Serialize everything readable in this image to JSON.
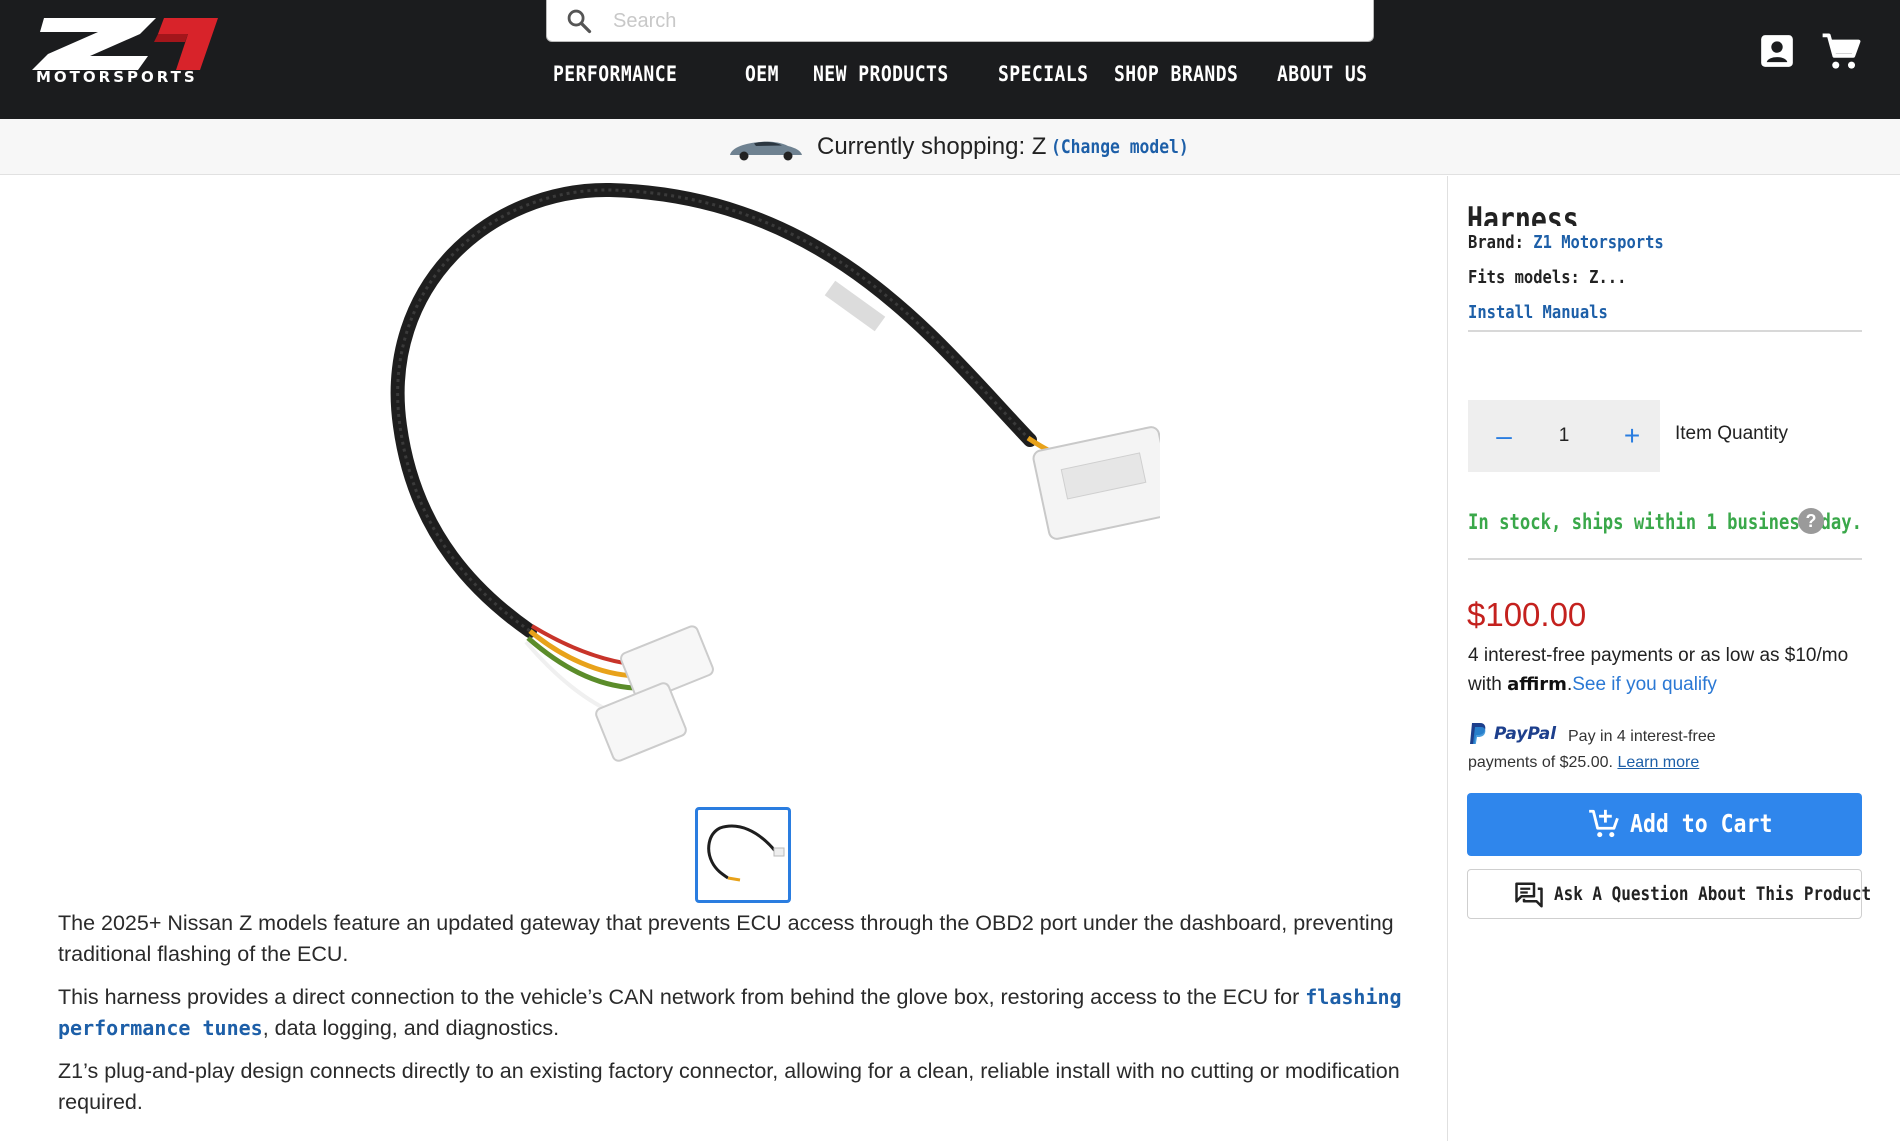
{
  "header": {
    "logo_text": "MOTORSPORTS",
    "logo_mark": "Z1",
    "search_placeholder": "Search",
    "nav": [
      {
        "label": "PERFORMANCE"
      },
      {
        "label": "OEM"
      },
      {
        "label": "NEW PRODUCTS"
      },
      {
        "label": "SPECIALS"
      },
      {
        "label": "SHOP BRANDS"
      },
      {
        "label": "ABOUT US"
      }
    ],
    "icons": [
      "search-icon",
      "account-icon",
      "cart-icon"
    ]
  },
  "shopbar": {
    "text": "Currently shopping: Z",
    "change_label": "(Change model)"
  },
  "product": {
    "title": "Harness",
    "brand_label": "Brand:",
    "brand_value": "Z1 Motorsports",
    "fits_label": "Fits models:",
    "fits_value": "Z...",
    "install_manuals": "Install Manuals",
    "quantity": "1",
    "quantity_label": "Item Quantity",
    "minus_label": "–",
    "plus_label": "+",
    "stock": "In stock, ships within 1 business day.",
    "help_label": "?",
    "price": "$100.00",
    "affirm_line1": "4 interest-free payments or as low as $10/mo",
    "affirm_with": "with",
    "affirm_logo": "affirm",
    "affirm_link": "See if you qualify",
    "paypal_brand": "PayPal",
    "paypal_line1": "Pay in 4 interest-free",
    "paypal_line2": "payments of $25.00.",
    "paypal_learn": "Learn more",
    "add_to_cart": "Add to Cart",
    "ask_question": "Ask A Question About This Product"
  },
  "description": {
    "p1": "The 2025+ Nissan Z models feature an updated gateway that prevents ECU access through the OBD2 port under the dashboard, preventing traditional flashing of the ECU.",
    "p2_before": "This harness provides a direct connection to the vehicle’s CAN network from behind the glove box, restoring access to the ECU for ",
    "p2_link": "flashing performance tunes",
    "p2_after": ", data logging, and diagnostics.",
    "p3": "Z1’s plug-and-play design connects directly to an existing factory connector, allowing for a clean, reliable install with no cutting or modification required."
  },
  "colors": {
    "header_bg": "#1b1c1e",
    "accent_blue": "#2f86ec",
    "link_blue": "#1d5fa8",
    "price_red": "#c4211e",
    "stock_green": "#3aa84a"
  }
}
